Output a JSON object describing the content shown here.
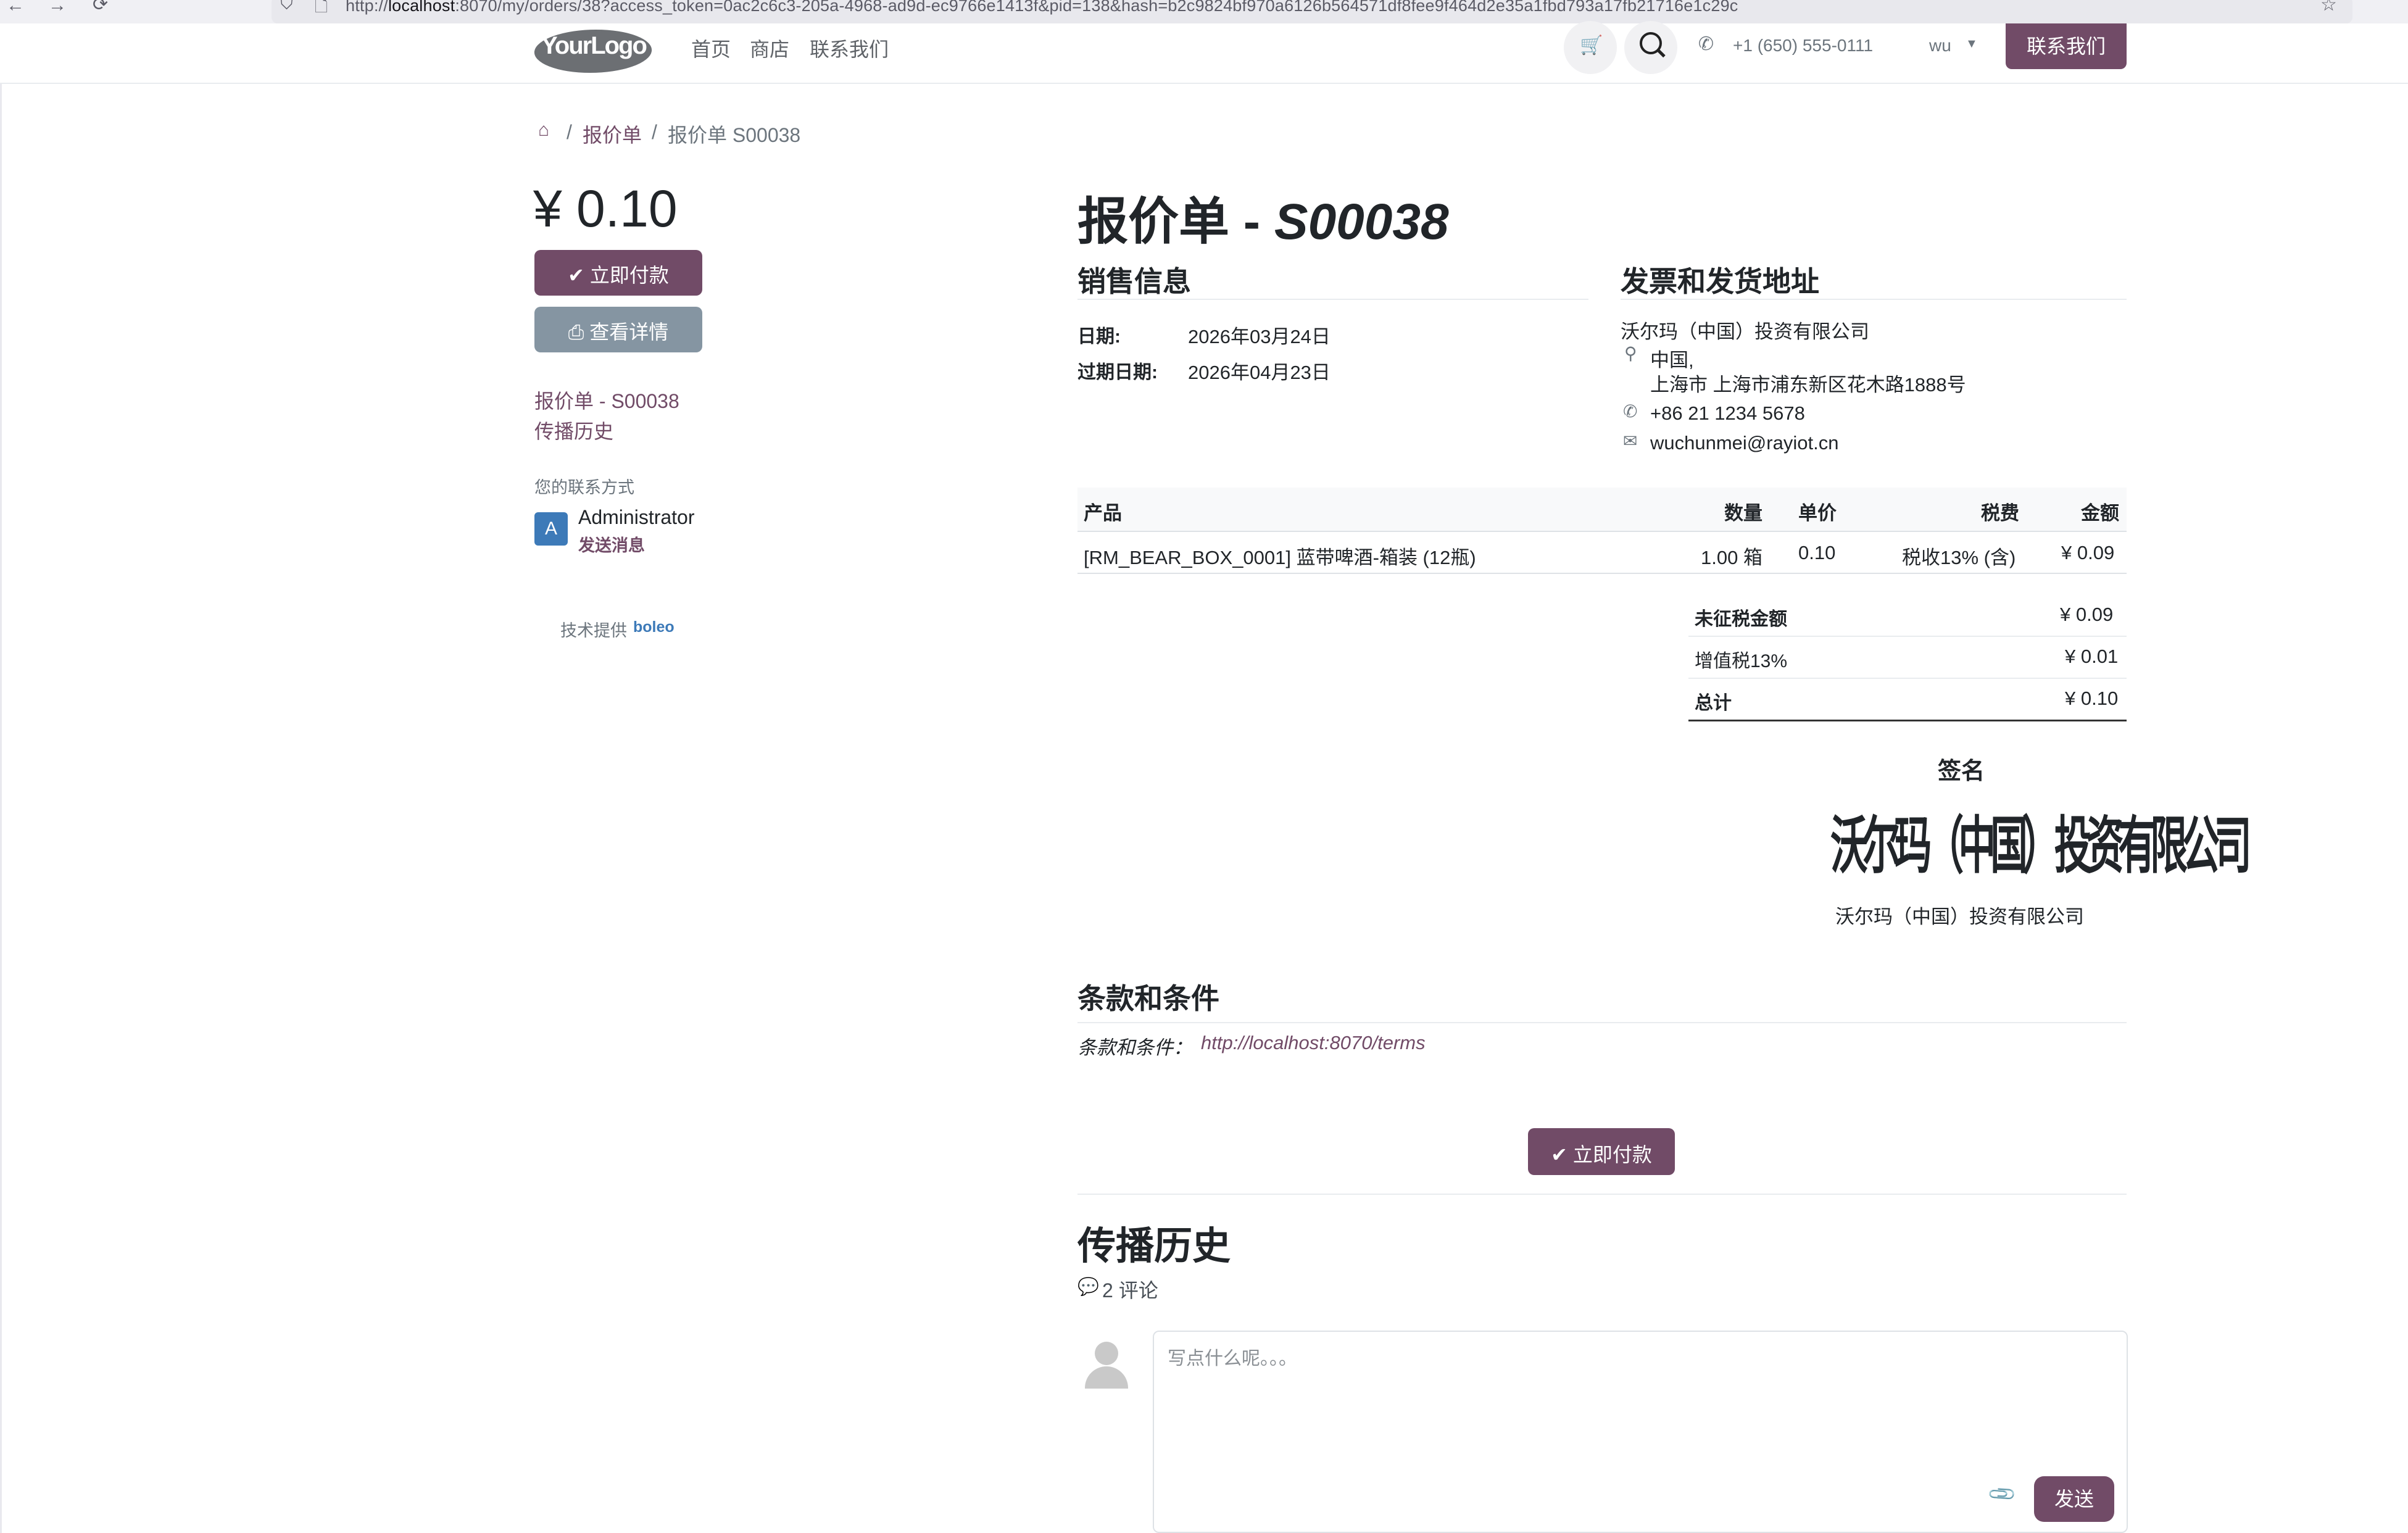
{
  "browser": {
    "url_prefix": "http://",
    "url_host": "localhost",
    "url_rest": ":8070/my/orders/38?access_token=0ac2c6c3-205a-4968-ad9d-ec9766e1413f&pid=138&hash=b2c9824bf970a6126b564571df8fee9f464d2e35a1fbd793a17fb21716e1c29c"
  },
  "header": {
    "logo_text": "YourLogo",
    "nav": [
      "首页",
      "商店",
      "联系我们"
    ],
    "phone": "+1 (650) 555-0111",
    "user": "wu",
    "contact_button": "联系我们"
  },
  "breadcrumb": {
    "items": [
      "报价单",
      "报价单 S00038"
    ]
  },
  "sidebar": {
    "amount": "¥ 0.10",
    "pay_button": "立即付款",
    "view_button": "查看详情",
    "links": [
      "报价单 - S00038",
      "传播历史"
    ],
    "contact_label": "您的联系方式",
    "contact_initial": "A",
    "contact_name": "Administrator",
    "send_message": "发送消息",
    "powered_by": "技术提供",
    "powered_brand": "boleo"
  },
  "main": {
    "title_prefix": "报价单 - ",
    "title_ref": "S00038",
    "sales_info_title": "销售信息",
    "date_label": "日期:",
    "date_value": "2026年03月24日",
    "expiry_label": "过期日期:",
    "expiry_value": "2026年04月23日",
    "address_title": "发票和发货地址",
    "company": "沃尔玛（中国）投资有限公司",
    "country": "中国,",
    "address": "上海市 上海市浦东新区花木路1888号",
    "phone": "+86 21 1234 5678",
    "email": "wuchunmei@rayiot.cn"
  },
  "table": {
    "headers": [
      "产品",
      "数量",
      "单价",
      "税费",
      "金额"
    ],
    "rows": [
      [
        "[RM_BEAR_BOX_0001] 蓝带啤酒-箱装 (12瓶)",
        "1.00 箱",
        "0.10",
        "税收13% (含)",
        "¥ 0.09"
      ]
    ]
  },
  "totals": [
    {
      "label": "未征税金额",
      "value": "¥ 0.09"
    },
    {
      "label": "增值税13%",
      "value": "¥ 0.01"
    },
    {
      "label": "总计",
      "value": "¥ 0.10"
    }
  ],
  "signature": {
    "title": "签名",
    "signature_text": "沃尔玛（中国）投资有限公司",
    "signer": "沃尔玛（中国）投资有限公司"
  },
  "terms": {
    "title": "条款和条件",
    "label": "条款和条件：",
    "link": "http://localhost:8070/terms"
  },
  "bottom_pay_button": "立即付款",
  "history": {
    "title": "传播历史",
    "comments": "2 评论",
    "placeholder": "写点什么呢。。。",
    "send_button": "发送"
  },
  "colors": {
    "primary": "#714b67",
    "secondary": "#8595a2",
    "badge": "#3d7ab8"
  }
}
